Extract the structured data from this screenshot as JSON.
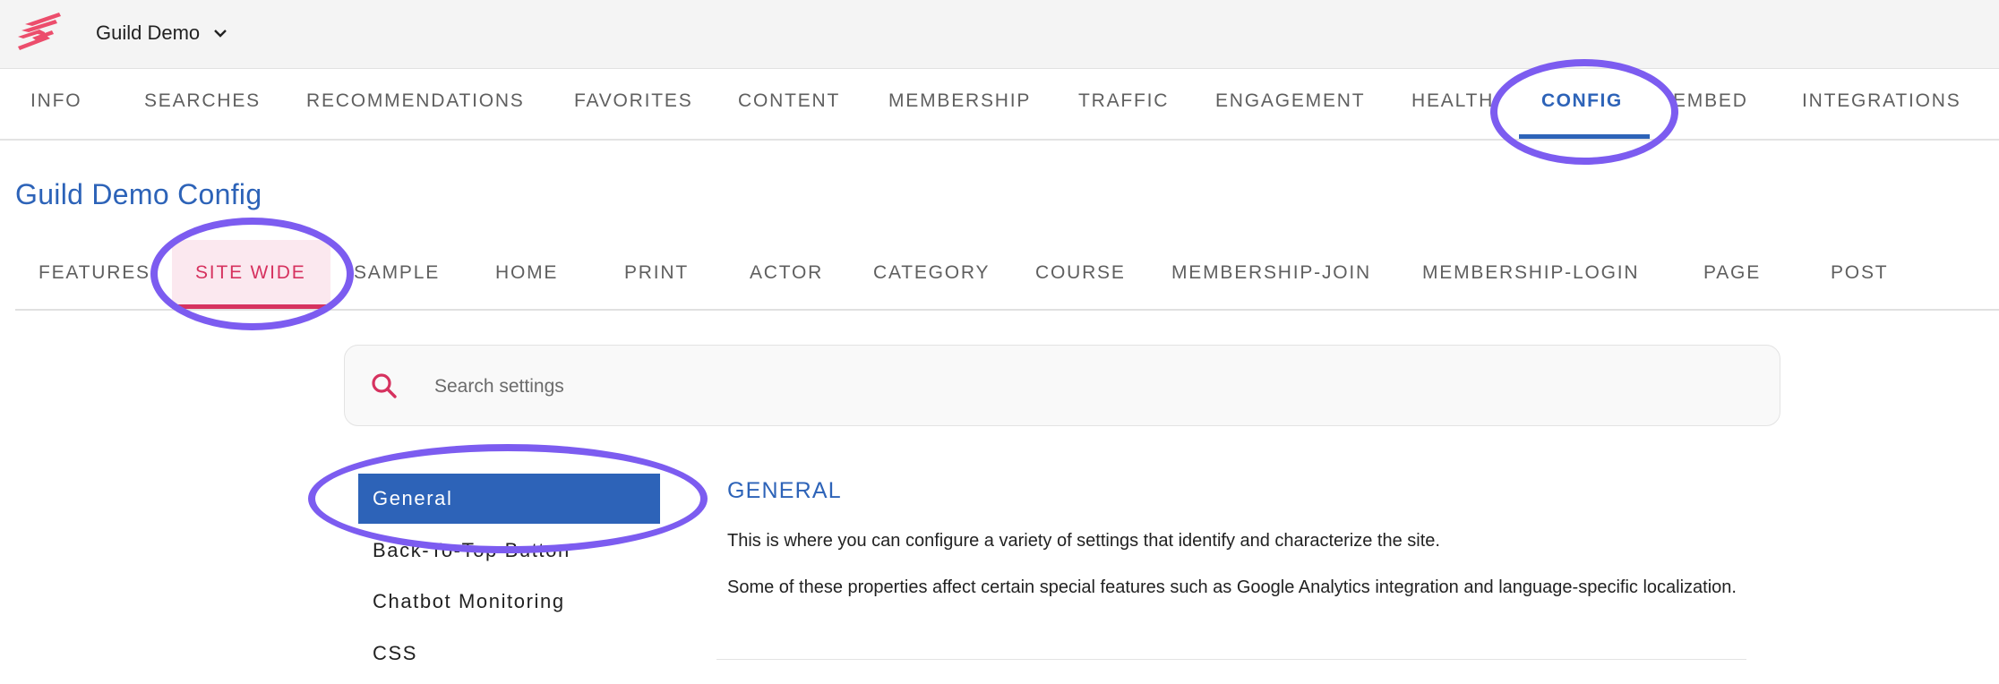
{
  "header": {
    "logo_icon": "guild-logo-icon",
    "workspace_name": "Guild Demo",
    "workspace_chevron_icon": "chevron-down-icon"
  },
  "top_nav": {
    "tabs": [
      {
        "label": "INFO"
      },
      {
        "label": "SEARCHES"
      },
      {
        "label": "RECOMMENDATIONS"
      },
      {
        "label": "FAVORITES"
      },
      {
        "label": "CONTENT"
      },
      {
        "label": "MEMBERSHIP"
      },
      {
        "label": "TRAFFIC"
      },
      {
        "label": "ENGAGEMENT"
      },
      {
        "label": "HEALTH"
      },
      {
        "label": "CONFIG",
        "active": true
      },
      {
        "label": "EMBED"
      },
      {
        "label": "INTEGRATIONS"
      }
    ],
    "active_tab": "CONFIG"
  },
  "page": {
    "title": "Guild Demo Config"
  },
  "sub_tabs": {
    "tabs": [
      {
        "label": "FEATURES"
      },
      {
        "label": "SITE WIDE",
        "active": true
      },
      {
        "label": "SAMPLE"
      },
      {
        "label": "HOME"
      },
      {
        "label": "PRINT"
      },
      {
        "label": "ACTOR"
      },
      {
        "label": "CATEGORY"
      },
      {
        "label": "COURSE"
      },
      {
        "label": "MEMBERSHIP-JOIN"
      },
      {
        "label": "MEMBERSHIP-LOGIN"
      },
      {
        "label": "PAGE"
      },
      {
        "label": "POST"
      }
    ],
    "active_tab": "SITE WIDE"
  },
  "search": {
    "icon": "search-icon",
    "placeholder": "Search settings",
    "value": ""
  },
  "settings_menu": {
    "items": [
      {
        "label": "General",
        "selected": true
      },
      {
        "label": "Back-To-Top Button"
      },
      {
        "label": "Chatbot Monitoring"
      },
      {
        "label": "CSS"
      }
    ]
  },
  "section": {
    "heading": "GENERAL",
    "paragraphs": [
      "This is where you can configure a variety of settings that identify and characterize the site.",
      "Some of these properties affect certain special features such as Google Analytics integration and language-specific localization."
    ]
  },
  "colors": {
    "primary_blue": "#2d63b8",
    "accent_pink": "#d6325f",
    "active_subtab_bg": "#fbe8ef",
    "annotation_purple": "#7c5cf0",
    "header_bg": "#f4f4f4",
    "tab_text": "#5f5f5f"
  },
  "annotations": [
    {
      "type": "ellipse",
      "target": "CONFIG tab"
    },
    {
      "type": "ellipse",
      "target": "SITE WIDE tab"
    },
    {
      "type": "ellipse",
      "target": "General menu item"
    }
  ]
}
